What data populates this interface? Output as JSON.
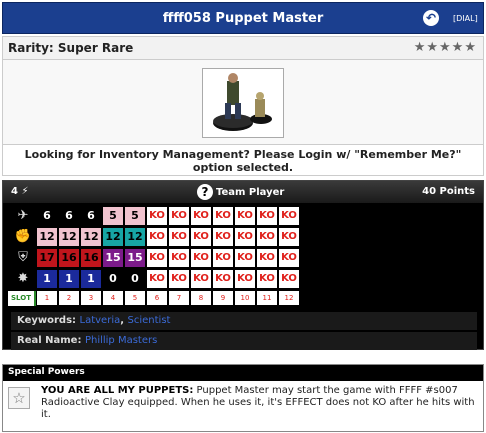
{
  "header": {
    "title": "ffff058 Puppet Master",
    "dial_button": "[DIAL]"
  },
  "rarity": {
    "label": "Rarity: Super Rare",
    "stars": "★★★★★"
  },
  "login_message": "Looking for Inventory Management? Please Login w/ \"Remember Me?\" option selected.",
  "dial": {
    "range": "4",
    "team": "Team Player",
    "points": "40 Points",
    "rows": [
      {
        "stat": "speed",
        "vals": [
          "6",
          "6",
          "6",
          "5",
          "5"
        ],
        "colors": [
          "#000",
          "#000",
          "#000",
          "#f1c3cf",
          "#f1c3cf"
        ],
        "fg": [
          "#fff",
          "#fff",
          "#fff",
          "#000",
          "#000"
        ]
      },
      {
        "stat": "attack",
        "vals": [
          "12",
          "12",
          "12",
          "12",
          "12"
        ],
        "colors": [
          "#f1c3cf",
          "#f1c3cf",
          "#f1c3cf",
          "#17a5a5",
          "#17a5a5"
        ],
        "fg": [
          "#000",
          "#000",
          "#000",
          "#000",
          "#000"
        ]
      },
      {
        "stat": "defense",
        "vals": [
          "17",
          "16",
          "16",
          "15",
          "15"
        ],
        "colors": [
          "#c0151c",
          "#c0151c",
          "#c0151c",
          "#7c1b8a",
          "#7c1b8a"
        ],
        "fg": [
          "#000",
          "#000",
          "#000",
          "#fff",
          "#fff"
        ]
      },
      {
        "stat": "damage",
        "vals": [
          "1",
          "1",
          "1",
          "0",
          "0"
        ],
        "colors": [
          "#1b2a9b",
          "#1b2a9b",
          "#1b2a9b",
          "#000",
          "#000"
        ],
        "fg": [
          "#fff",
          "#fff",
          "#fff",
          "#fff",
          "#fff"
        ]
      }
    ],
    "ko_label": "KO",
    "ko_count": 7,
    "slot_label": "SLOT",
    "slots": [
      "1",
      "2",
      "3",
      "4",
      "5",
      "6",
      "7",
      "8",
      "9",
      "10",
      "11",
      "12"
    ],
    "keywords_label": "Keywords:",
    "keywords": [
      "Latveria",
      "Scientist"
    ],
    "realname_label": "Real Name:",
    "realname": "Phillip Masters"
  },
  "special_powers": {
    "header": "Special Powers",
    "power_name": "YOU ARE ALL MY PUPPETS:",
    "power_text": " Puppet Master may start the game with FFFF #s007 Radioactive Clay equipped. When he uses it, it's EFFECT does not KO after he hits with it."
  },
  "colors": {
    "header_bg": "#1b3f8f",
    "ko_text": "#e0201b",
    "link": "#3b6bd8"
  }
}
